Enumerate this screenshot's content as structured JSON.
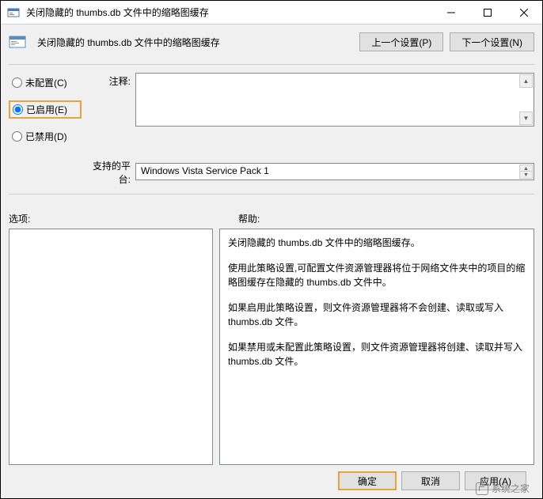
{
  "title_bar": {
    "title": "关闭隐藏的 thumbs.db 文件中的缩略图缓存"
  },
  "header": {
    "policy_title": "关闭隐藏的 thumbs.db 文件中的缩略图缓存",
    "prev_button": "上一个设置(P)",
    "next_button": "下一个设置(N)"
  },
  "radios": {
    "not_configured": "未配置(C)",
    "enabled": "已启用(E)",
    "disabled": "已禁用(D)"
  },
  "fields": {
    "comment_label": "注释:",
    "comment_value": "",
    "platforms_label": "支持的平台:",
    "platforms_value": "Windows Vista Service Pack 1"
  },
  "labels": {
    "options": "选项:",
    "help": "帮助:"
  },
  "help": {
    "line1": "关闭隐藏的 thumbs.db 文件中的缩略图缓存。",
    "line2": "使用此策略设置,可配置文件资源管理器将位于网络文件夹中的项目的缩略图缓存在隐藏的 thumbs.db 文件中。",
    "line3": "如果启用此策略设置，则文件资源管理器将不会创建、读取或写入 thumbs.db 文件。",
    "line4": "如果禁用或未配置此策略设置，则文件资源管理器将创建、读取并写入 thumbs.db 文件。"
  },
  "footer": {
    "ok": "确定",
    "cancel": "取消",
    "apply": "应用(A)"
  },
  "watermark": {
    "text": "系统之家"
  }
}
